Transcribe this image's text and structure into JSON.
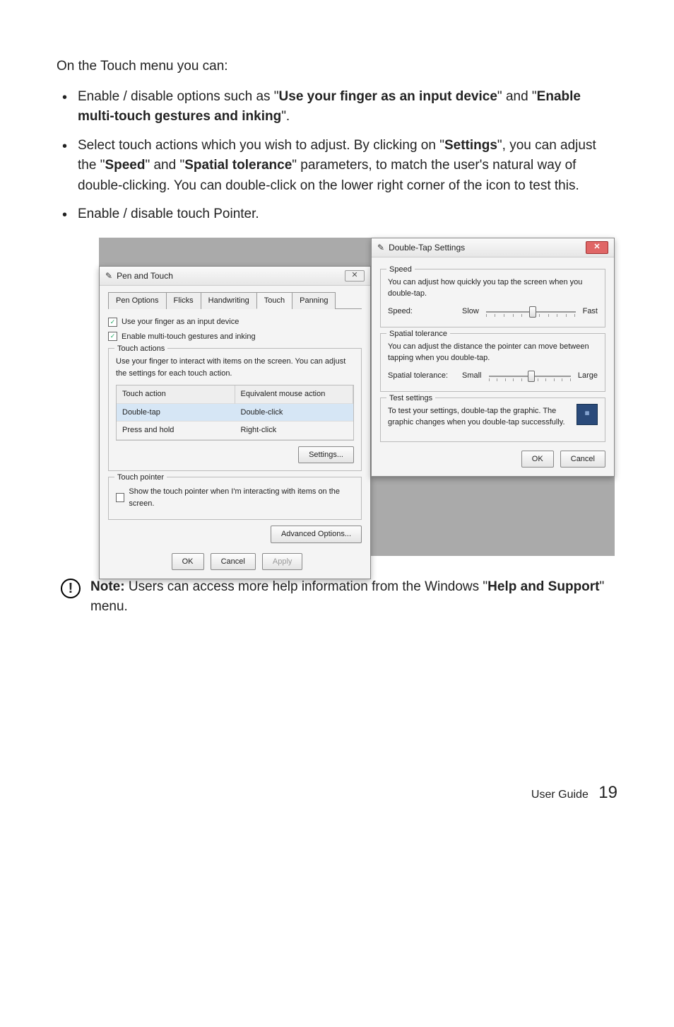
{
  "intro": "On the Touch menu you can:",
  "bullets": {
    "b1a": "Enable / disable options such as \"",
    "b1b": "Use your finger as an input device",
    "b1c": "\" and \"",
    "b1d": "Enable multi-touch gestures and inking",
    "b1e": "\".",
    "b2a": "Select touch actions which you wish to adjust. By clicking on \"",
    "b2b": "Settings",
    "b2c": "\", you can adjust the \"",
    "b2d": "Speed",
    "b2e": "\" and \"",
    "b2f": "Spatial tolerance",
    "b2g": "\" parameters, to match the user's natural way of double-clicking. You can double-click on the lower right corner of the icon to test this.",
    "b3": "Enable / disable touch Pointer."
  },
  "left": {
    "title": "Pen and Touch",
    "tabs": {
      "t1": "Pen Options",
      "t2": "Flicks",
      "t3": "Handwriting",
      "t4": "Touch",
      "t5": "Panning"
    },
    "chk1": "Use your finger as an input device",
    "chk2": "Enable multi-touch gestures and inking",
    "grp1": {
      "title": "Touch actions",
      "desc": "Use your finger to interact with items on the screen. You can adjust the settings for each touch action.",
      "hd1": "Touch action",
      "hd2": "Equivalent mouse action",
      "r1c1": "Double-tap",
      "r1c2": "Double-click",
      "r2c1": "Press and hold",
      "r2c2": "Right-click",
      "settings_btn": "Settings..."
    },
    "grp2": {
      "title": "Touch pointer",
      "chk": "Show the touch pointer when I'm interacting with items on the screen."
    },
    "adv": "Advanced Options...",
    "ok": "OK",
    "cancel": "Cancel",
    "apply": "Apply"
  },
  "right": {
    "title": "Double-Tap Settings",
    "speed": {
      "title": "Speed",
      "desc": "You can adjust how quickly you tap the screen when you double-tap.",
      "label": "Speed:",
      "min": "Slow",
      "max": "Fast"
    },
    "spatial": {
      "title": "Spatial tolerance",
      "desc": "You can adjust the distance the pointer can move between tapping when you double-tap.",
      "label": "Spatial tolerance:",
      "min": "Small",
      "max": "Large"
    },
    "test": {
      "title": "Test settings",
      "desc": "To test your settings, double-tap the graphic. The graphic changes when you double-tap successfully."
    },
    "ok": "OK",
    "cancel": "Cancel"
  },
  "note": {
    "lead": "Note:",
    "t1": " Users can access more help information from the Windows \"",
    "t2": "Help and Support",
    "t3": "\" menu."
  },
  "footer": {
    "label": "User Guide",
    "page": "19"
  }
}
